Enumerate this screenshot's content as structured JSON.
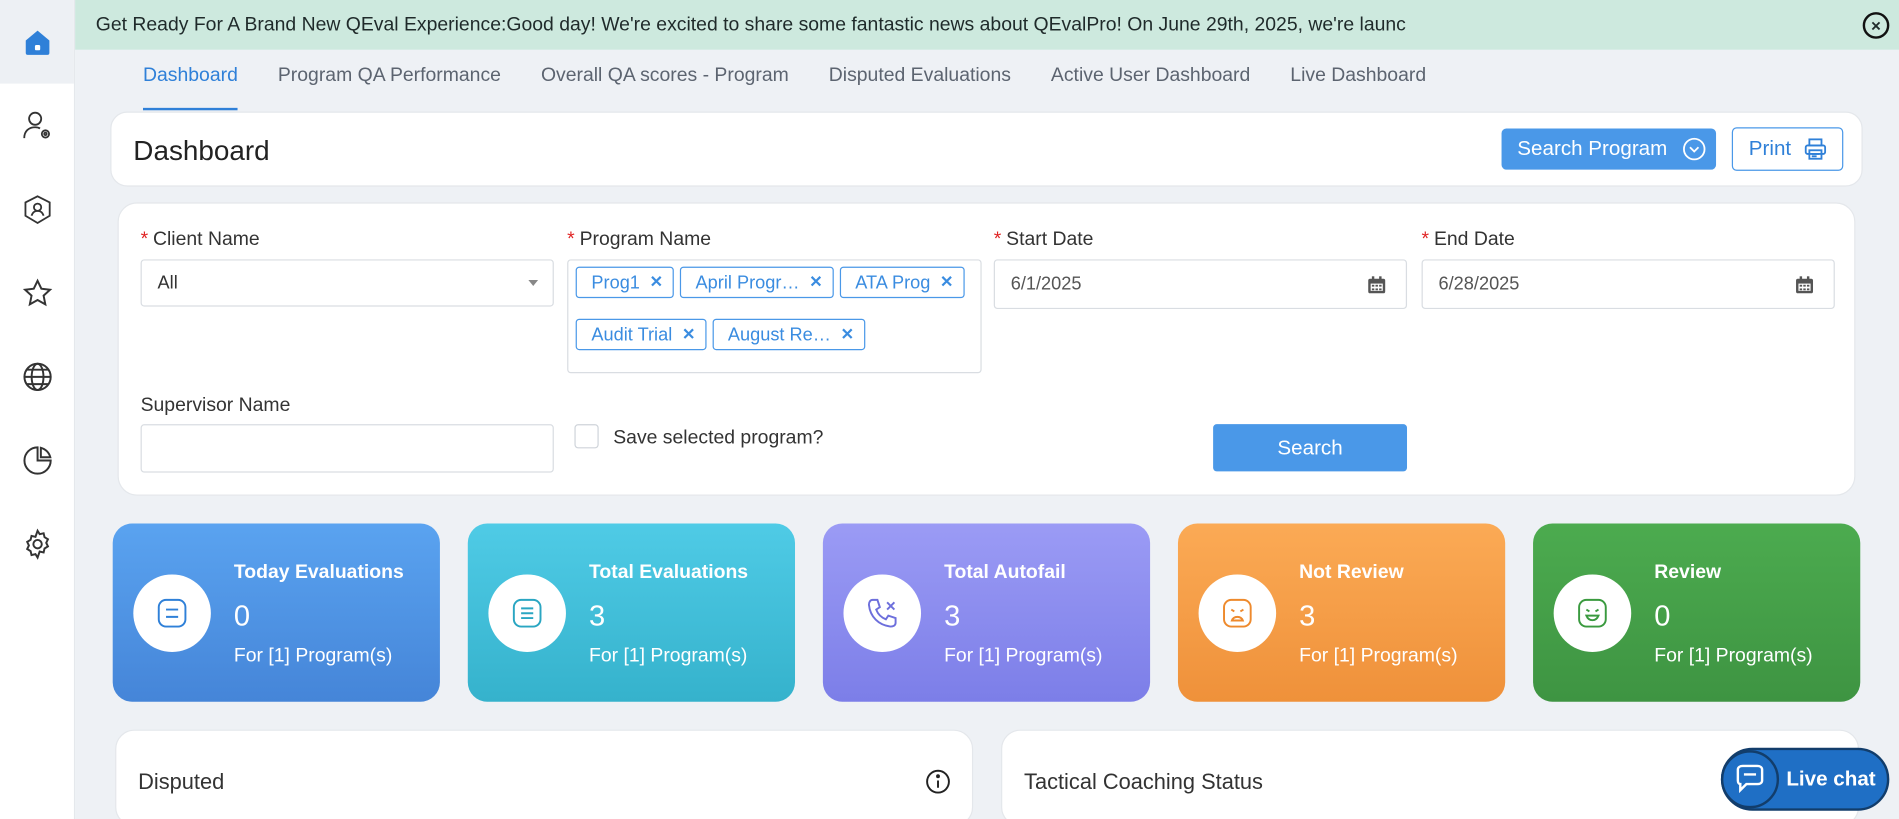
{
  "banner": {
    "text": "Get Ready For A Brand New QEval Experience:Good day! We're excited to share some fantastic news about QEvalPro! On June 29th, 2025, we're launc"
  },
  "sidebar": {
    "items": [
      {
        "icon": "home-icon"
      },
      {
        "icon": "user-settings-icon"
      },
      {
        "icon": "shield-icon"
      },
      {
        "icon": "star-icon"
      },
      {
        "icon": "globe-icon"
      },
      {
        "icon": "pie-chart-icon"
      },
      {
        "icon": "gear-icon"
      }
    ]
  },
  "tabs": [
    {
      "label": "Dashboard",
      "active": true
    },
    {
      "label": "Program QA Performance"
    },
    {
      "label": "Overall QA scores - Program"
    },
    {
      "label": "Disputed Evaluations"
    },
    {
      "label": "Active User Dashboard"
    },
    {
      "label": "Live Dashboard"
    }
  ],
  "header": {
    "title": "Dashboard",
    "search_program_label": "Search Program",
    "print_label": "Print"
  },
  "filters": {
    "client_name_label": "Client Name",
    "client_name_value": "All",
    "program_name_label": "Program Name",
    "programs": [
      "Prog1",
      "April Progr…",
      "ATA Prog",
      "Audit Trial",
      "August Re…"
    ],
    "start_date_label": "Start Date",
    "start_date_value": "6/1/2025",
    "end_date_label": "End Date",
    "end_date_value": "6/28/2025",
    "supervisor_label": "Supervisor Name",
    "supervisor_value": "",
    "save_program_label": "Save selected program?",
    "search_label": "Search"
  },
  "cards": [
    {
      "title": "Today Evaluations",
      "value": "0",
      "sub": "For [1] Program(s)",
      "color": "#4a90e2",
      "icon": "list-icon"
    },
    {
      "title": "Total Evaluations",
      "value": "3",
      "sub": "For [1] Program(s)",
      "color": "#3bbfd8",
      "icon": "list-icon"
    },
    {
      "title": "Total Autofail",
      "value": "3",
      "sub": "For [1] Program(s)",
      "color": "#8b8cf0",
      "icon": "phone-x-icon"
    },
    {
      "title": "Not Review",
      "value": "3",
      "sub": "For [1] Program(s)",
      "color": "#f49b45",
      "icon": "sad-face-icon"
    },
    {
      "title": "Review",
      "value": "0",
      "sub": "For [1] Program(s)",
      "color": "#44a04a",
      "icon": "happy-face-icon"
    }
  ],
  "panels": {
    "disputed_title": "Disputed",
    "coaching_title": "Tactical Coaching Status"
  },
  "livechat": {
    "label": "Live chat"
  }
}
